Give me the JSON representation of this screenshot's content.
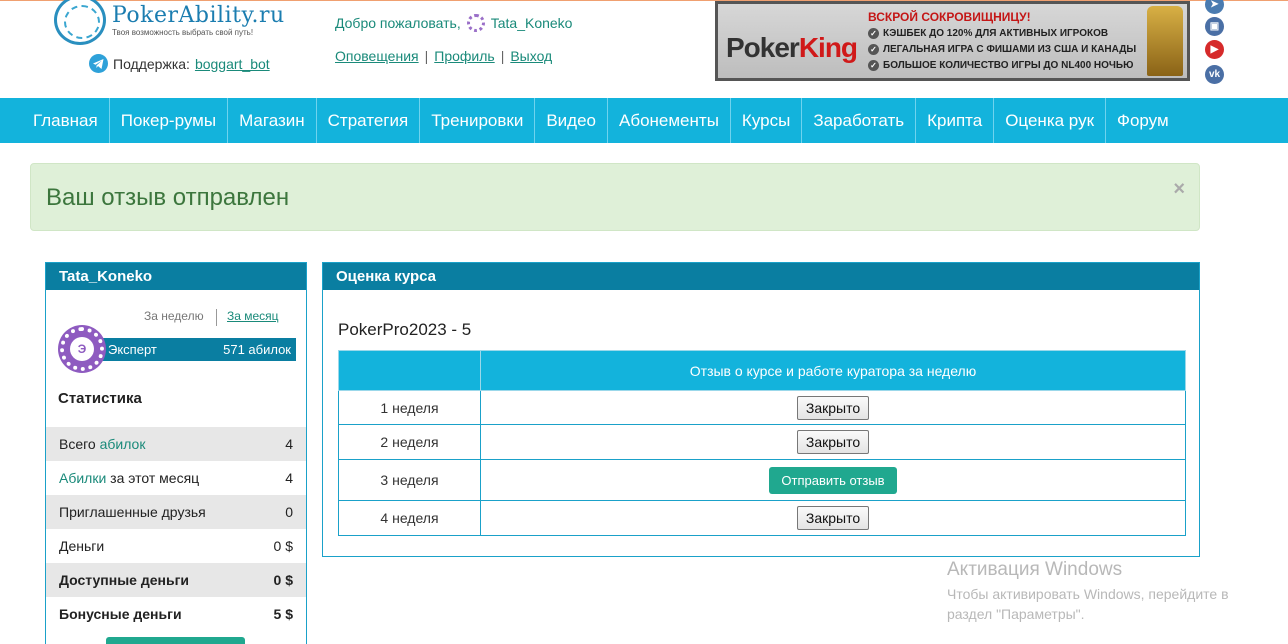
{
  "header": {
    "logo_title": "PokerAbility.ru",
    "logo_tagline": "Твоя возможность выбрать свой путь!",
    "support_label": "Поддержка:",
    "support_link": "boggart_bot",
    "welcome_text": "Добро пожаловать,",
    "username": "Tata_Koneko",
    "links": [
      "Оповещения",
      "Профиль",
      "Выход"
    ]
  },
  "banner": {
    "brand_a": "Poker",
    "brand_b": "King",
    "headline": "ВСКРОЙ СОКРОВИЩНИЦУ!",
    "lines": [
      "КЭШБЕК ДО 120% ДЛЯ АКТИВНЫХ ИГРОКОВ",
      "ЛЕГАЛЬНАЯ ИГРА С ФИШАМИ ИЗ США И КАНАДЫ",
      "БОЛЬШОЕ КОЛИЧЕСТВО ИГРЫ ДО NL400 НОЧЬЮ"
    ]
  },
  "nav": [
    "Главная",
    "Покер-румы",
    "Магазин",
    "Стратегия",
    "Тренировки",
    "Видео",
    "Абонементы",
    "Курсы",
    "Заработать",
    "Крипта",
    "Оценка рук",
    "Форум"
  ],
  "alert": {
    "text": "Ваш отзыв отправлен",
    "close": "×"
  },
  "sidebar": {
    "title": "Tata_Koneko",
    "period_week": "За неделю",
    "period_month": "За месяц",
    "rank_chip": "Э",
    "rank_level": "Эксперт",
    "rank_points": "571 абилок",
    "stats_title": "Статистика",
    "stats": [
      {
        "label_a": "Всего ",
        "label_link": "абилок",
        "label_b": "",
        "value": "4"
      },
      {
        "label_a": "",
        "label_link": "Абилки",
        "label_b": " за этот месяц",
        "value": "4"
      },
      {
        "label_a": "Приглашенные друзья",
        "label_link": "",
        "label_b": "",
        "value": "0"
      },
      {
        "label_a": "Деньги",
        "label_link": "",
        "label_b": "",
        "value": "0 $"
      },
      {
        "label_a": "Доступные деньги",
        "label_link": "",
        "label_b": "",
        "value": "0 $"
      },
      {
        "label_a": "Бонусные деньги",
        "label_link": "",
        "label_b": "",
        "value": "5 $"
      }
    ]
  },
  "main": {
    "title": "Оценка курса",
    "course": "PokerPro2023 - 5",
    "column_header": "Отзыв о курсе и работе куратора за неделю",
    "weeks": [
      {
        "label": "1 неделя",
        "action": "Закрыто"
      },
      {
        "label": "2 неделя",
        "action": "Закрыто"
      },
      {
        "label": "3 неделя",
        "action": "Отправить отзыв"
      },
      {
        "label": "4 неделя",
        "action": "Закрыто"
      }
    ]
  },
  "watermark": {
    "title": "Активация Windows",
    "line1": "Чтобы активировать Windows, перейдите в",
    "line2": "раздел \"Параметры\"."
  },
  "colors": {
    "nav": "#13b3dc",
    "panel_header": "#0a7ea1",
    "accent": "#20a88f",
    "alert_bg": "#dff0d8",
    "alert_text": "#3c763d"
  },
  "social_icons": [
    "telegram-icon",
    "twitch-icon",
    "youtube-icon",
    "vk-icon"
  ]
}
